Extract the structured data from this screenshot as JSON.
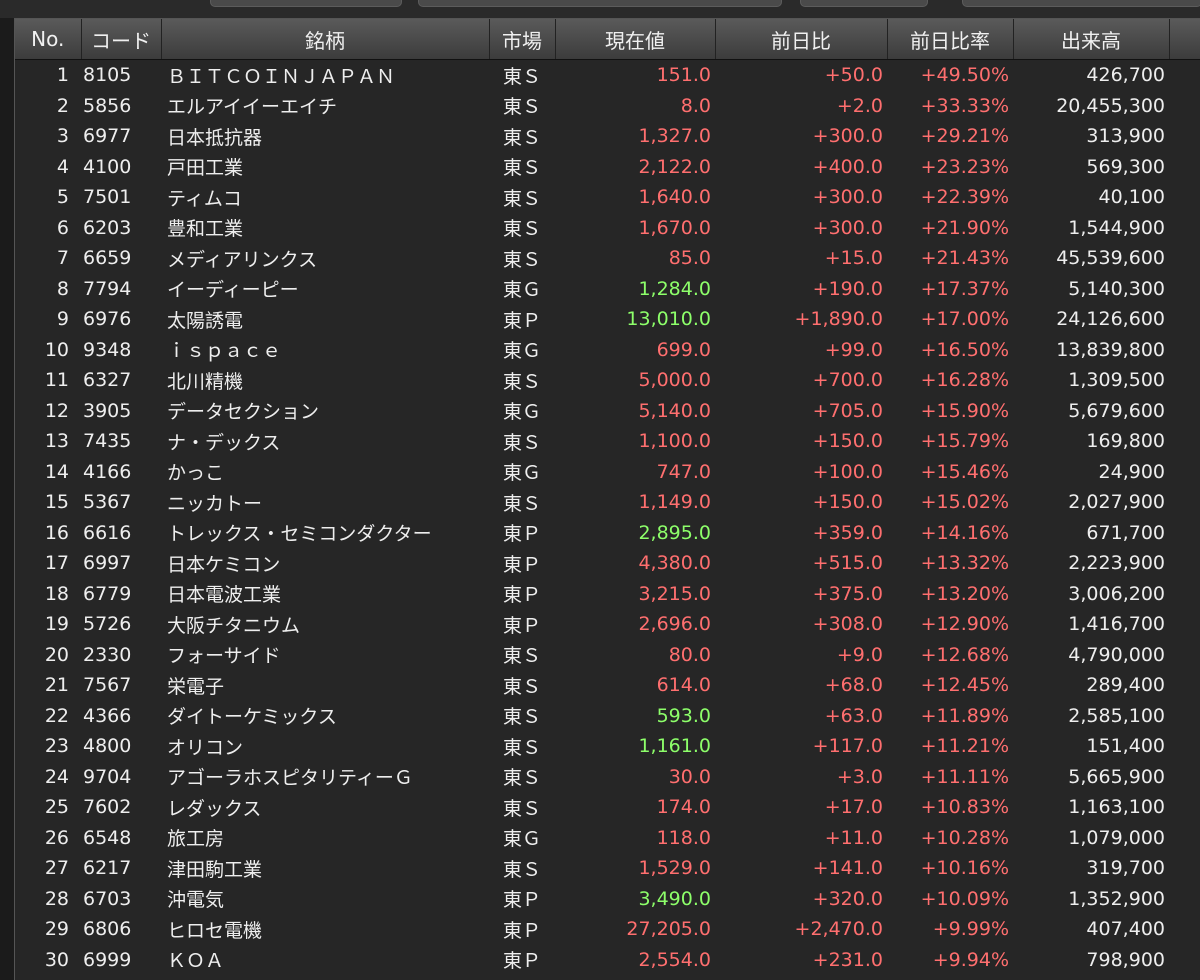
{
  "headers": {
    "no": "No.",
    "code": "コード",
    "name": "銘柄",
    "market": "市場",
    "price": "現在値",
    "change": "前日比",
    "change_pct": "前日比率",
    "volume": "出来高"
  },
  "colors": {
    "up": "#ff6f6f",
    "highlight": "#8dff6a",
    "text": "#eeeeee",
    "background": "#262626"
  },
  "rows": [
    {
      "no": "1",
      "code": "8105",
      "name": "ＢＩＴＣＯＩＮＪＡＰＡＮ",
      "market": "東Ｓ",
      "price": "151.0",
      "price_color": "red",
      "change": "+50.0",
      "change_pct": "+49.50%",
      "volume": "426,700"
    },
    {
      "no": "2",
      "code": "5856",
      "name": "エルアイイーエイチ",
      "market": "東Ｓ",
      "price": "8.0",
      "price_color": "red",
      "change": "+2.0",
      "change_pct": "+33.33%",
      "volume": "20,455,300"
    },
    {
      "no": "3",
      "code": "6977",
      "name": "日本抵抗器",
      "market": "東Ｓ",
      "price": "1,327.0",
      "price_color": "red",
      "change": "+300.0",
      "change_pct": "+29.21%",
      "volume": "313,900"
    },
    {
      "no": "4",
      "code": "4100",
      "name": "戸田工業",
      "market": "東Ｓ",
      "price": "2,122.0",
      "price_color": "red",
      "change": "+400.0",
      "change_pct": "+23.23%",
      "volume": "569,300"
    },
    {
      "no": "5",
      "code": "7501",
      "name": "ティムコ",
      "market": "東Ｓ",
      "price": "1,640.0",
      "price_color": "red",
      "change": "+300.0",
      "change_pct": "+22.39%",
      "volume": "40,100"
    },
    {
      "no": "6",
      "code": "6203",
      "name": "豊和工業",
      "market": "東Ｓ",
      "price": "1,670.0",
      "price_color": "red",
      "change": "+300.0",
      "change_pct": "+21.90%",
      "volume": "1,544,900"
    },
    {
      "no": "7",
      "code": "6659",
      "name": "メディアリンクス",
      "market": "東Ｓ",
      "price": "85.0",
      "price_color": "red",
      "change": "+15.0",
      "change_pct": "+21.43%",
      "volume": "45,539,600"
    },
    {
      "no": "8",
      "code": "7794",
      "name": "イーディーピー",
      "market": "東Ｇ",
      "price": "1,284.0",
      "price_color": "green",
      "change": "+190.0",
      "change_pct": "+17.37%",
      "volume": "5,140,300"
    },
    {
      "no": "9",
      "code": "6976",
      "name": "太陽誘電",
      "market": "東Ｐ",
      "price": "13,010.0",
      "price_color": "green",
      "change": "+1,890.0",
      "change_pct": "+17.00%",
      "volume": "24,126,600"
    },
    {
      "no": "10",
      "code": "9348",
      "name": "ｉｓｐａｃｅ",
      "market": "東Ｇ",
      "price": "699.0",
      "price_color": "red",
      "change": "+99.0",
      "change_pct": "+16.50%",
      "volume": "13,839,800"
    },
    {
      "no": "11",
      "code": "6327",
      "name": "北川精機",
      "market": "東Ｓ",
      "price": "5,000.0",
      "price_color": "red",
      "change": "+700.0",
      "change_pct": "+16.28%",
      "volume": "1,309,500"
    },
    {
      "no": "12",
      "code": "3905",
      "name": "データセクション",
      "market": "東Ｇ",
      "price": "5,140.0",
      "price_color": "red",
      "change": "+705.0",
      "change_pct": "+15.90%",
      "volume": "5,679,600"
    },
    {
      "no": "13",
      "code": "7435",
      "name": "ナ・デックス",
      "market": "東Ｓ",
      "price": "1,100.0",
      "price_color": "red",
      "change": "+150.0",
      "change_pct": "+15.79%",
      "volume": "169,800"
    },
    {
      "no": "14",
      "code": "4166",
      "name": "かっこ",
      "market": "東Ｇ",
      "price": "747.0",
      "price_color": "red",
      "change": "+100.0",
      "change_pct": "+15.46%",
      "volume": "24,900"
    },
    {
      "no": "15",
      "code": "5367",
      "name": "ニッカトー",
      "market": "東Ｓ",
      "price": "1,149.0",
      "price_color": "red",
      "change": "+150.0",
      "change_pct": "+15.02%",
      "volume": "2,027,900"
    },
    {
      "no": "16",
      "code": "6616",
      "name": "トレックス・セミコンダクター",
      "market": "東Ｐ",
      "price": "2,895.0",
      "price_color": "green",
      "change": "+359.0",
      "change_pct": "+14.16%",
      "volume": "671,700"
    },
    {
      "no": "17",
      "code": "6997",
      "name": "日本ケミコン",
      "market": "東Ｐ",
      "price": "4,380.0",
      "price_color": "red",
      "change": "+515.0",
      "change_pct": "+13.32%",
      "volume": "2,223,900"
    },
    {
      "no": "18",
      "code": "6779",
      "name": "日本電波工業",
      "market": "東Ｐ",
      "price": "3,215.0",
      "price_color": "red",
      "change": "+375.0",
      "change_pct": "+13.20%",
      "volume": "3,006,200"
    },
    {
      "no": "19",
      "code": "5726",
      "name": "大阪チタニウム",
      "market": "東Ｐ",
      "price": "2,696.0",
      "price_color": "red",
      "change": "+308.0",
      "change_pct": "+12.90%",
      "volume": "1,416,700"
    },
    {
      "no": "20",
      "code": "2330",
      "name": "フォーサイド",
      "market": "東Ｓ",
      "price": "80.0",
      "price_color": "red",
      "change": "+9.0",
      "change_pct": "+12.68%",
      "volume": "4,790,000"
    },
    {
      "no": "21",
      "code": "7567",
      "name": "栄電子",
      "market": "東Ｓ",
      "price": "614.0",
      "price_color": "red",
      "change": "+68.0",
      "change_pct": "+12.45%",
      "volume": "289,400"
    },
    {
      "no": "22",
      "code": "4366",
      "name": "ダイトーケミックス",
      "market": "東Ｓ",
      "price": "593.0",
      "price_color": "green",
      "change": "+63.0",
      "change_pct": "+11.89%",
      "volume": "2,585,100"
    },
    {
      "no": "23",
      "code": "4800",
      "name": "オリコン",
      "market": "東Ｓ",
      "price": "1,161.0",
      "price_color": "green",
      "change": "+117.0",
      "change_pct": "+11.21%",
      "volume": "151,400"
    },
    {
      "no": "24",
      "code": "9704",
      "name": "アゴーラホスピタリティーＧ",
      "market": "東Ｓ",
      "price": "30.0",
      "price_color": "red",
      "change": "+3.0",
      "change_pct": "+11.11%",
      "volume": "5,665,900"
    },
    {
      "no": "25",
      "code": "7602",
      "name": "レダックス",
      "market": "東Ｓ",
      "price": "174.0",
      "price_color": "red",
      "change": "+17.0",
      "change_pct": "+10.83%",
      "volume": "1,163,100"
    },
    {
      "no": "26",
      "code": "6548",
      "name": "旅工房",
      "market": "東Ｇ",
      "price": "118.0",
      "price_color": "red",
      "change": "+11.0",
      "change_pct": "+10.28%",
      "volume": "1,079,000"
    },
    {
      "no": "27",
      "code": "6217",
      "name": "津田駒工業",
      "market": "東Ｓ",
      "price": "1,529.0",
      "price_color": "red",
      "change": "+141.0",
      "change_pct": "+10.16%",
      "volume": "319,700"
    },
    {
      "no": "28",
      "code": "6703",
      "name": "沖電気",
      "market": "東Ｐ",
      "price": "3,490.0",
      "price_color": "green",
      "change": "+320.0",
      "change_pct": "+10.09%",
      "volume": "1,352,900"
    },
    {
      "no": "29",
      "code": "6806",
      "name": "ヒロセ電機",
      "market": "東Ｐ",
      "price": "27,205.0",
      "price_color": "red",
      "change": "+2,470.0",
      "change_pct": "+9.99%",
      "volume": "407,400"
    },
    {
      "no": "30",
      "code": "6999",
      "name": "ＫＯＡ",
      "market": "東Ｐ",
      "price": "2,554.0",
      "price_color": "red",
      "change": "+231.0",
      "change_pct": "+9.94%",
      "volume": "798,900"
    }
  ]
}
